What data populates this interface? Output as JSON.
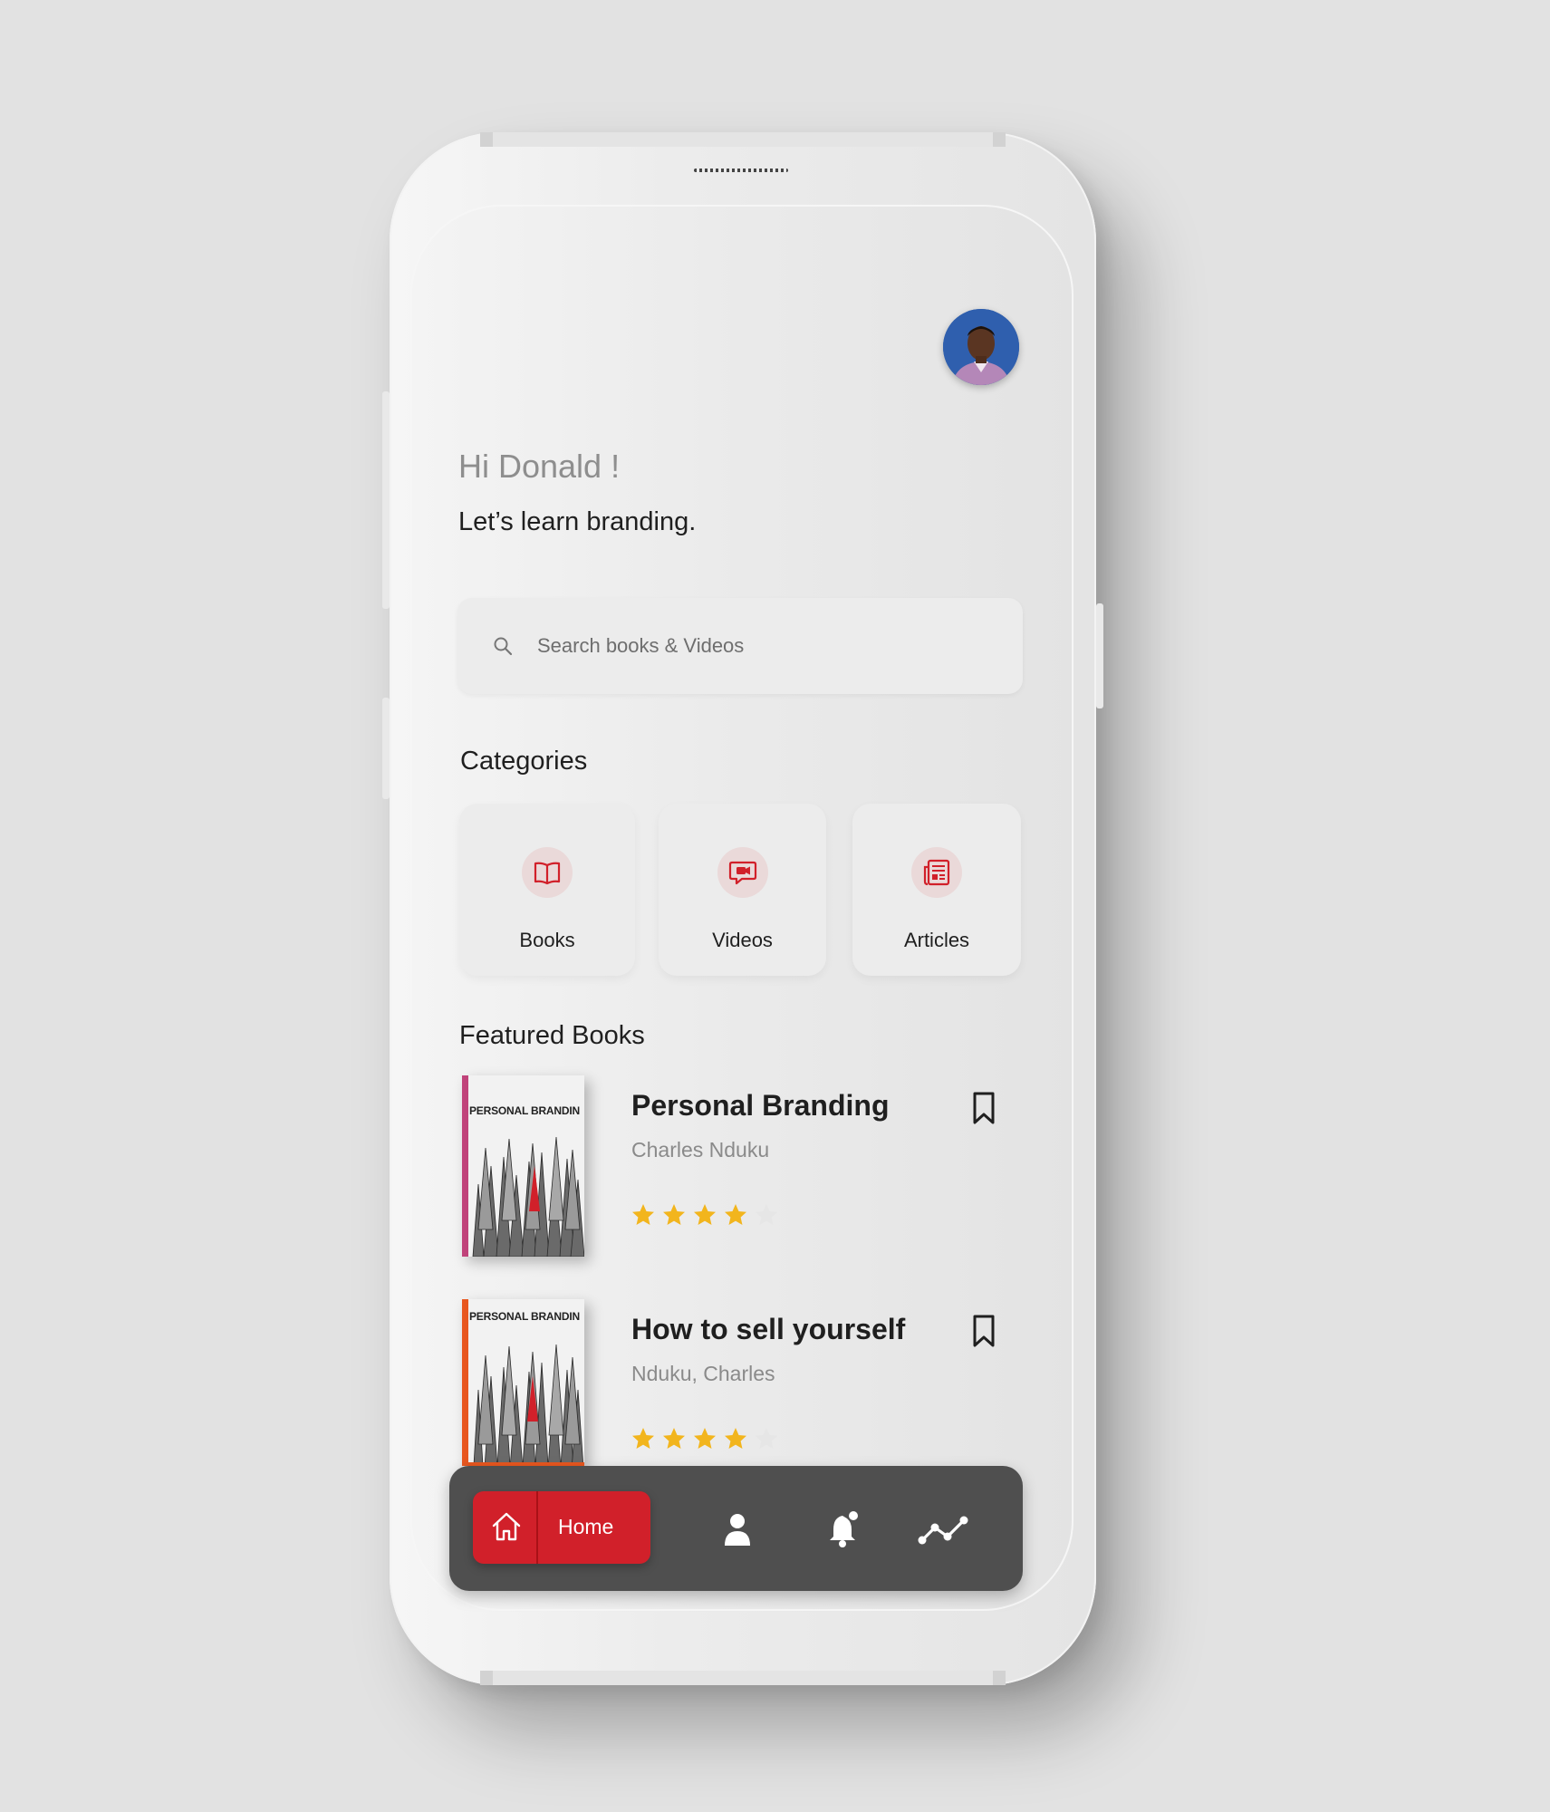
{
  "header": {
    "greeting": "Hi Donald !",
    "subtitle": "Let’s learn branding."
  },
  "search": {
    "placeholder": "Search books & Videos",
    "icon": "search-icon"
  },
  "categories": {
    "title": "Categories",
    "items": [
      {
        "label": "Books",
        "icon": "book-icon"
      },
      {
        "label": "Videos",
        "icon": "video-chat-icon"
      },
      {
        "label": "Articles",
        "icon": "newspaper-icon"
      }
    ]
  },
  "featured": {
    "title": "Featured Books",
    "books": [
      {
        "cover_text": "PERSONAL BRANDIN",
        "title": "Personal Branding",
        "author": "Charles Nduku",
        "rating": 4,
        "rating_max": 5,
        "spine_color": "#c0437a"
      },
      {
        "cover_text": "PERSONAL BRANDIN",
        "title": "How to sell yourself",
        "author": "Nduku, Charles",
        "rating": 4,
        "rating_max": 5,
        "spine_color": "#e8571f"
      }
    ]
  },
  "bottom_nav": {
    "home_label": "Home",
    "items": [
      "home-icon",
      "profile-icon",
      "notification-bell-icon",
      "analytics-icon"
    ]
  },
  "colors": {
    "accent": "#d1202a",
    "star": "#f2b51d",
    "star_empty": "#e6e6e6",
    "nav_bg": "#4f4f4f"
  }
}
